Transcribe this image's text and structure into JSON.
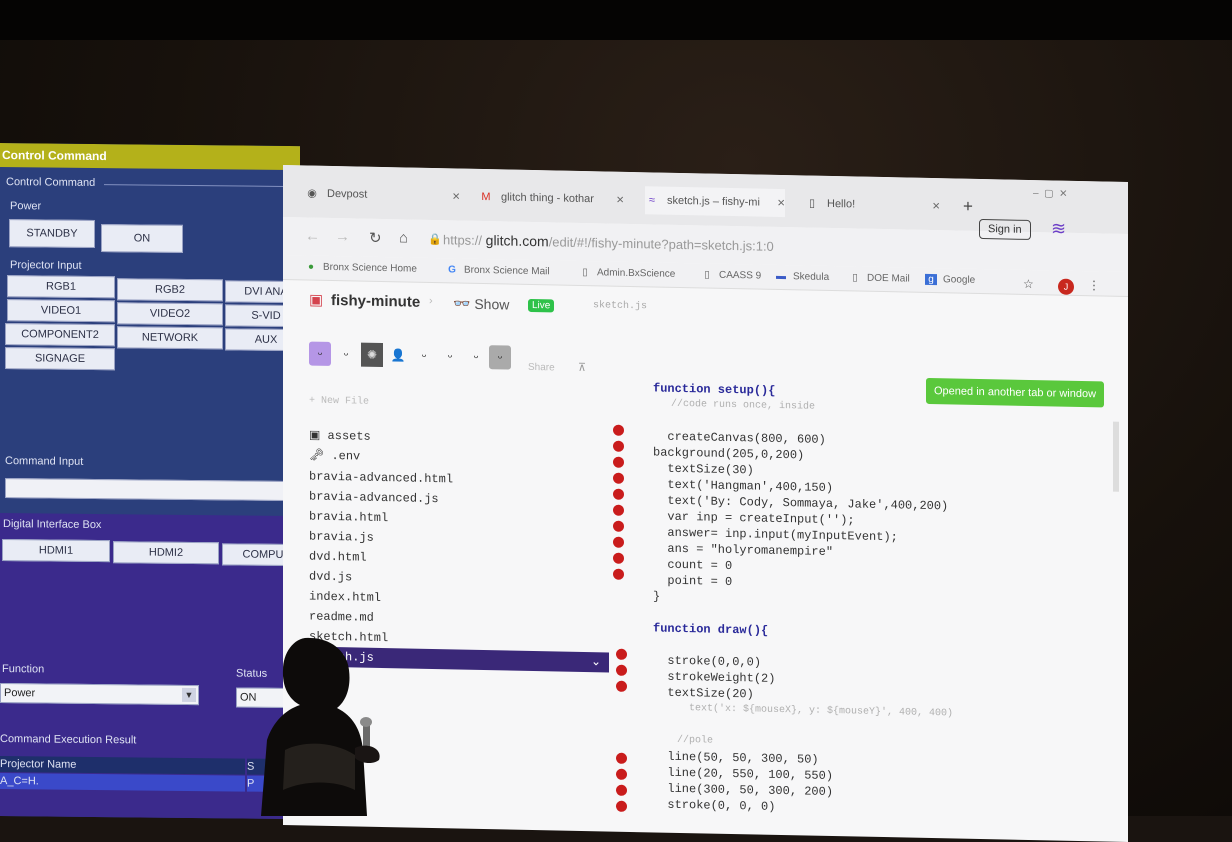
{
  "control_panel": {
    "title": "Control Command",
    "section": "Control Command",
    "power_label": "Power",
    "standby_button": "STANDBY",
    "on_button": "ON",
    "input_label": "Projector Input",
    "inputs": [
      "RGB1",
      "RGB2",
      "DVI ANA",
      "VIDEO1",
      "VIDEO2",
      "S-VID",
      "COMPONENT2",
      "NETWORK",
      "AUX",
      "SIGNAGE"
    ],
    "command_input_label": "Command Input",
    "dib_label": "Digital Interface Box",
    "dib_buttons": [
      "HDMI1",
      "HDMI2",
      "COMPU"
    ],
    "function_label": "Function",
    "status_label": "Status",
    "function_value": "Power",
    "status_value": "ON",
    "result_label": "Command Execution Result",
    "table_header": "Projector Name",
    "table_header_status": "S",
    "table_row": "A_C=H.",
    "table_row_status": "P"
  },
  "browser": {
    "tabs": [
      {
        "icon": "devpost-icon",
        "label": "Devpost"
      },
      {
        "icon": "gmail-icon",
        "label": "glitch thing - kothar"
      },
      {
        "icon": "glitch-icon",
        "label": "sketch.js – fishy-mi"
      },
      {
        "icon": "page-icon",
        "label": "Hello!"
      }
    ],
    "new_tab": "+",
    "url_scheme": "https://",
    "url_host": "glitch.com",
    "url_path": "/edit/#!/fishy-minute?path=sketch.js:1:0",
    "bookmarks": [
      "Bronx Science Home",
      "Bronx Science Mail",
      "Admin.BxScience",
      "CAASS 9",
      "Skedula",
      "DOE Mail",
      "Google"
    ],
    "profile_initial": "J"
  },
  "glitch": {
    "project_name": "fishy-minute",
    "show_label": "Show",
    "live_badge": "Live",
    "current_file": "sketch.js",
    "sign_in": "Sign in",
    "share_label": "Share",
    "new_file": "+ New File",
    "files": [
      "assets",
      ".env",
      "bravia-advanced.html",
      "bravia-advanced.js",
      "bravia.html",
      "bravia.js",
      "dvd.html",
      "dvd.js",
      "index.html",
      "readme.md",
      "sketch.html",
      "sketch.js"
    ],
    "toast": "Opened in another tab or window",
    "code_lines": [
      "function setup(){",
      "   //code runs once, inside",
      "",
      "  createCanvas(800, 600)",
      "background(205,0,200)",
      "  textSize(30)",
      "  text('Hangman',400,150)",
      "  text('By: Cody, Sommaya, Jake',400,200)",
      "  var inp = createInput('');",
      "  answer= inp.input(myInputEvent);",
      "  ans = \"holyromanempire\"",
      "  count = 0",
      "  point = 0",
      "}",
      "",
      "function draw(){",
      "",
      "  stroke(0,0,0)",
      "  strokeWeight(2)",
      "  textSize(20)",
      "      text('x: ${mouseX}, y: ${mouseY}', 400, 400)",
      "",
      "    //pole",
      "  line(50, 50, 300, 50)",
      "  line(20, 550, 100, 550)",
      "  line(300, 50, 300, 200)",
      "  stroke(0, 0, 0)"
    ]
  }
}
